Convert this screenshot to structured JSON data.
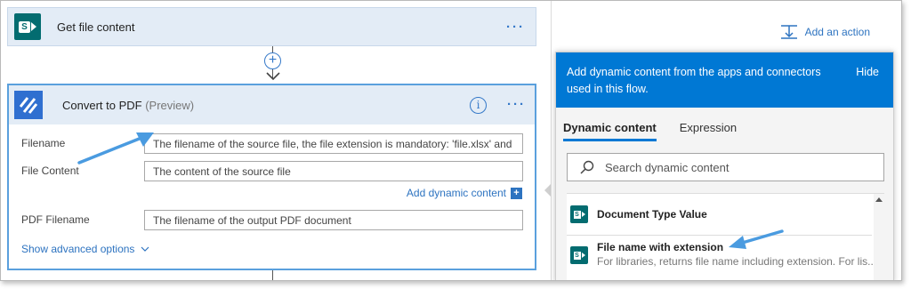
{
  "get_file_card": {
    "title": "Get file content",
    "menu": "···"
  },
  "convert_card": {
    "title": "Convert to PDF",
    "preview": "(Preview)",
    "menu": "···",
    "info": "i",
    "fields": [
      {
        "label": "Filename",
        "value": "The filename of the source file, the file extension is mandatory: 'file.xlsx' and"
      },
      {
        "label": "File Content",
        "value": "The content of the source file"
      },
      {
        "label": "PDF Filename",
        "value": "The filename of the output PDF document"
      }
    ],
    "add_dynamic_label": "Add dynamic content",
    "add_dynamic_plus": "+",
    "show_advanced": "Show advanced options"
  },
  "right": {
    "add_action": "Add an action"
  },
  "dynamic_panel": {
    "header_text": "Add dynamic content from the apps and connectors used in this flow.",
    "hide": "Hide",
    "tabs": [
      "Dynamic content",
      "Expression"
    ],
    "search_placeholder": "Search dynamic content",
    "items": [
      {
        "name": "Document Type Value",
        "desc": ""
      },
      {
        "name": "File name with extension",
        "desc": "For libraries, returns file name including extension. For lis..."
      }
    ]
  },
  "colors": {
    "accent": "#0078d4",
    "sharepoint": "#036c70",
    "card_header": "#e3ecf6",
    "pdf_icon": "#2f6fd0"
  }
}
